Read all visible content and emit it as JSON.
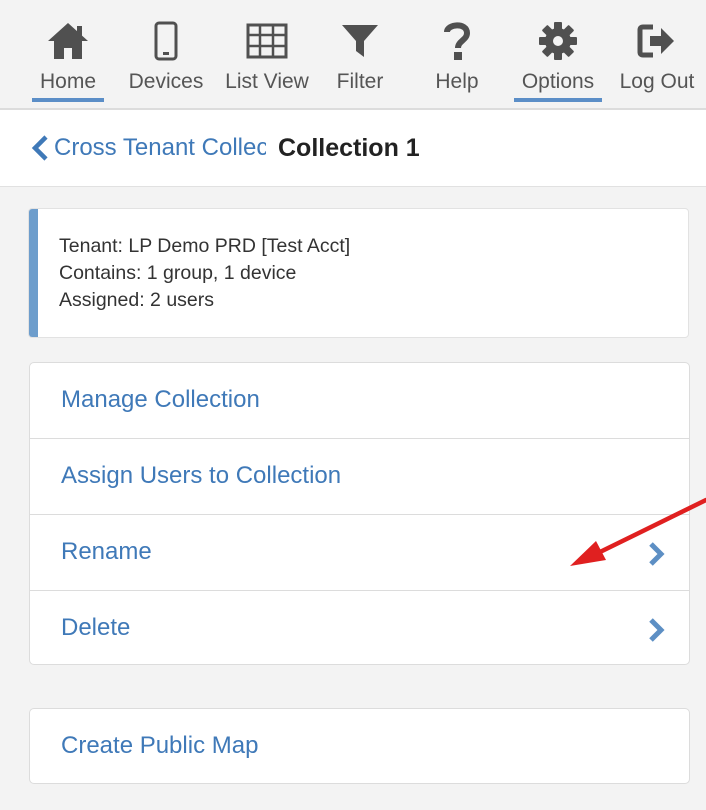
{
  "toolbar": {
    "items": [
      {
        "label": "Home",
        "icon": "home-icon",
        "active": true
      },
      {
        "label": "Devices",
        "icon": "mobile-device-icon",
        "active": false
      },
      {
        "label": "List View",
        "icon": "grid-table-icon",
        "active": false
      },
      {
        "label": "Filter",
        "icon": "filter-funnel-icon",
        "active": false
      },
      {
        "label": "Help",
        "icon": "question-mark-icon",
        "active": false
      },
      {
        "label": "Options",
        "icon": "gear-icon",
        "active": true
      },
      {
        "label": "Log Out",
        "icon": "logout-icon",
        "active": false
      }
    ],
    "active_underline_color": "#5b8ec7"
  },
  "header": {
    "back_label": "Cross Tenant Collections",
    "title": "Collection 1"
  },
  "info": {
    "tenant": "Tenant: LP Demo PRD [Test Acct]",
    "contains": "Contains: 1 group, 1 device",
    "assigned": "Assigned: 2 users",
    "accent_color": "#6d9dcc"
  },
  "menu": {
    "items": [
      {
        "label": "Manage Collection",
        "chevron": false
      },
      {
        "label": "Assign Users to Collection",
        "chevron": false
      },
      {
        "label": "Rename",
        "chevron": true
      },
      {
        "label": "Delete",
        "chevron": true
      }
    ]
  },
  "public_map": {
    "label": "Create Public Map"
  },
  "colors": {
    "link": "#3f79b8",
    "annotation_arrow": "#e02020"
  }
}
